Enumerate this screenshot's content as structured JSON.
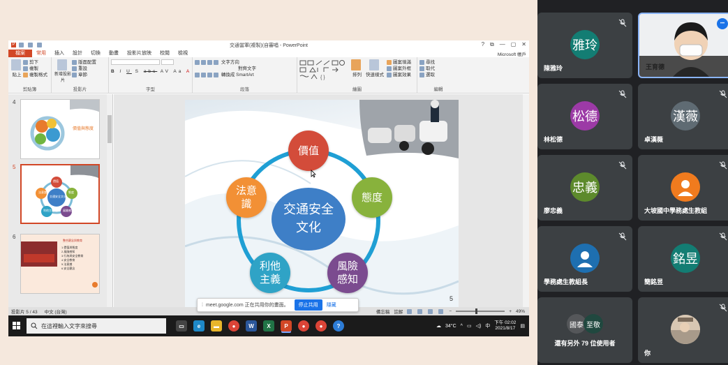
{
  "ppt": {
    "window_title": "交通當軍(複製)(自審唱 - PowerPoint",
    "window_controls": [
      "?",
      "⧉",
      "—",
      "▢",
      "✕"
    ],
    "tabs": [
      "檔案",
      "常用",
      "插入",
      "設計",
      "切換",
      "動畫",
      "投影片放映",
      "校閱",
      "檢視"
    ],
    "account": "Microsoft 帳戶",
    "ribbon_groups": {
      "clipboard": {
        "name": "剪貼簿",
        "paste": "貼上",
        "cut": "剪下",
        "copy": "複製",
        "format": "複製格式"
      },
      "slides": {
        "name": "投影片",
        "new": "新增投影片",
        "layout": "版面配置",
        "reset": "重設",
        "section": "章節"
      },
      "font": {
        "name": "字型",
        "bold": "B",
        "italic": "I",
        "underline": "U",
        "shadow": "S",
        "strike": "abc",
        "spacing": "AV",
        "case": "Aa",
        "color": "A"
      },
      "paragraph": {
        "name": "段落",
        "direction": "文字方向",
        "align": "對齊文字",
        "smartart": "轉換成 SmartArt"
      },
      "drawing": {
        "name": "繪圖",
        "arrange": "排列",
        "quick_styles": "快速樣式",
        "fill": "圖案填滿",
        "outline": "圖案外框",
        "effects": "圖案效果"
      },
      "editing": {
        "name": "編輯",
        "find": "尋找",
        "replace": "取代",
        "select": "選取"
      }
    },
    "thumbnails": [
      {
        "num": "4",
        "caption": "價值與態度"
      },
      {
        "num": "5",
        "labels": [
          "價值",
          "態度",
          "風險感知",
          "利他主義",
          "法意識"
        ],
        "center": "交通安全文化"
      },
      {
        "num": "6",
        "title": "整合觀念與教育",
        "bullets": [
          "1.價值與態度",
          "2.風險感知",
          "3.行為與安全教育",
          "4.安全教育",
          "5.法意識",
          "6.安全觀念"
        ]
      }
    ],
    "slide": {
      "center": "交通安全\n文化",
      "nodes": [
        {
          "label": "價值",
          "color": "#d34c3a"
        },
        {
          "label": "態度",
          "color": "#88b23c"
        },
        {
          "label": "風險\n感知",
          "color": "#7b4b8f"
        },
        {
          "label": "利他\n主義",
          "color": "#2fa3c6"
        },
        {
          "label": "法意\n識",
          "color": "#f29035"
        }
      ],
      "page_number": "5"
    },
    "status": {
      "slide_info": "投影片 5 / 43",
      "lang": "中文 (台灣)",
      "notes": "備忘稿",
      "comments": "註解",
      "zoom": "49%"
    },
    "share_bar": {
      "text": "meet.google.com 正在共用你的畫面。",
      "stop": "停止共用",
      "hide": "隱藏"
    },
    "taskbar": {
      "search_placeholder": "在這裡輸入文字來搜尋",
      "weather": "34°C",
      "ime": "中",
      "time": "下午 02:02",
      "date": "2021/8/17"
    }
  },
  "participants": [
    {
      "name": "陳雅玲",
      "avatar": "雅玲",
      "color": "#137d73",
      "muted": true
    },
    {
      "name": "王育德",
      "video": true,
      "muted": false
    },
    {
      "name": "林松德",
      "avatar": "松德",
      "color": "#9c3aa6",
      "muted": true
    },
    {
      "name": "卓漢薇",
      "avatar": "漢薇",
      "color": "#5f6b73",
      "muted": true
    },
    {
      "name": "廖忠義",
      "avatar": "忠義",
      "color": "#5d8a2c",
      "muted": true
    },
    {
      "name": "大坡國中學務處生教組",
      "avatar": "person",
      "color": "#f07b1e",
      "muted": true
    },
    {
      "name": "學務處生教組長",
      "avatar": "person",
      "color": "#1e6fb0",
      "muted": true
    },
    {
      "name": "簡銘昱",
      "avatar": "銘昱",
      "color": "#137d73",
      "muted": true
    },
    {
      "name": "還有另外 79 位使用者",
      "avatars": [
        "國泰",
        "至敬"
      ]
    },
    {
      "name": "你",
      "avatar": "photo",
      "muted": true
    }
  ]
}
